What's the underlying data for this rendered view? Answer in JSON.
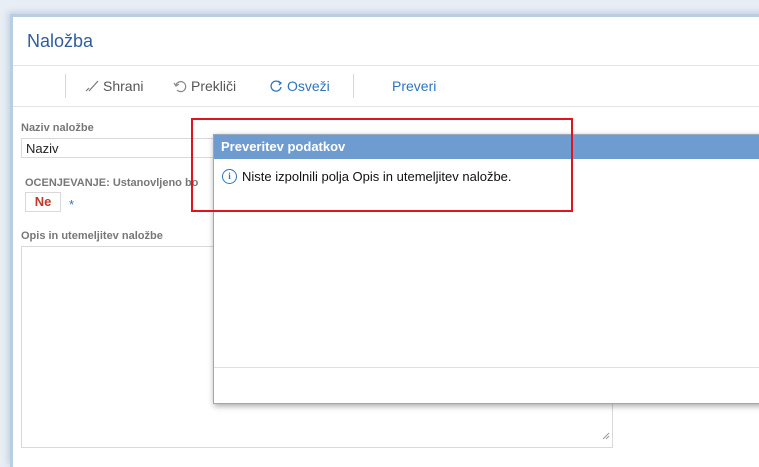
{
  "page": {
    "title": "Naložba"
  },
  "toolbar": {
    "save_label": "Shrani",
    "cancel_label": "Prekliči",
    "refresh_label": "Osveži",
    "check_label": "Preveri"
  },
  "form": {
    "name_label": "Naziv naložbe",
    "name_value": "Naziv",
    "assessment_label": "OCENJEVANJE: Ustanovljeno bo",
    "assessment_value": "Ne",
    "required_mark": "*",
    "description_label": "Opis in utemeljitev naložbe",
    "description_value": ""
  },
  "dialog": {
    "title": "Preveritev podatkov",
    "message": "Niste izpolnili polja Opis in utemeljitev naložbe."
  },
  "colors": {
    "header_blue": "#6e9bd0",
    "accent_blue": "#2e74c0",
    "highlight_red": "#e0141e",
    "ne_red": "#c0392b"
  }
}
